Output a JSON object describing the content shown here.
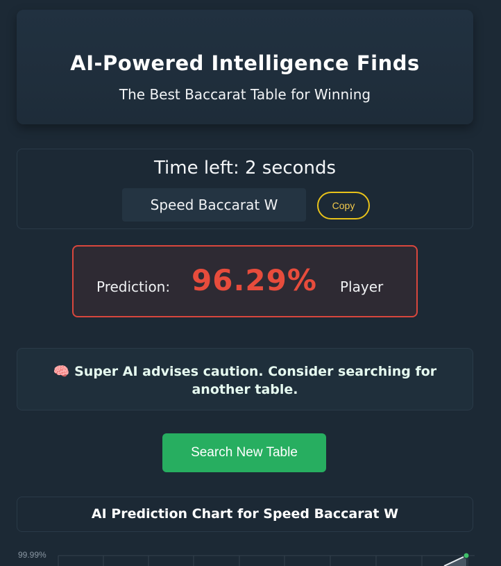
{
  "hero": {
    "title": "AI-Powered Intelligence Finds",
    "subtitle": "The Best Baccarat Table for Winning"
  },
  "timer": {
    "text": "Time left: 2 seconds",
    "table_name": "Speed Baccarat W",
    "copy_label": "Copy"
  },
  "prediction": {
    "label": "Prediction:",
    "value": "96.29%",
    "side": "Player",
    "accent_color": "#e74c3c"
  },
  "advice": {
    "icon": "brain-icon",
    "icon_glyph": "🧠",
    "text": "Super AI advises caution. Consider searching for another table."
  },
  "search_button": {
    "label": "Search New Table",
    "color": "#27ae60"
  },
  "chart": {
    "title": "AI Prediction Chart for Speed Baccarat W",
    "y_top_label": "99.99%"
  },
  "chart_data": {
    "type": "line",
    "title": "AI Prediction Chart for Speed Baccarat W",
    "ytick_labels": [
      "99.99%"
    ]
  }
}
